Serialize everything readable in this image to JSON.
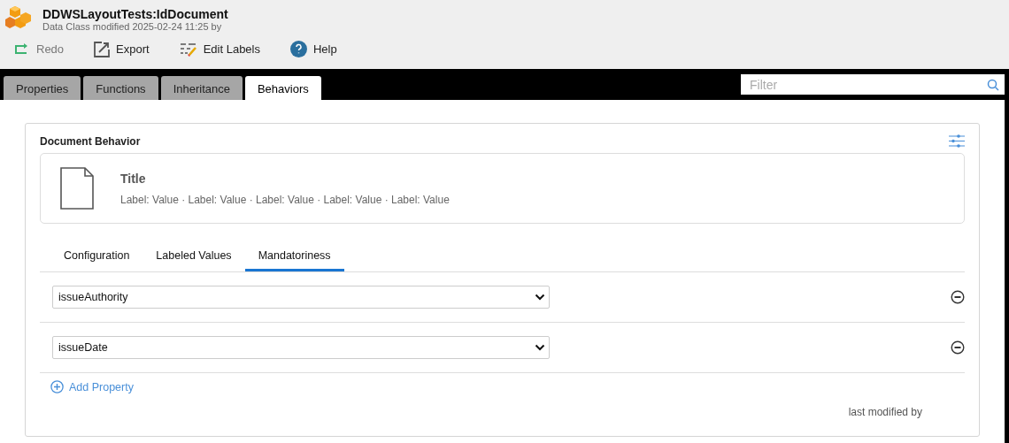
{
  "header": {
    "title": "DDWSLayoutTests:IdDocument",
    "subtitle": "Data Class modified 2025-02-24 11:25 by"
  },
  "toolbar": [
    {
      "kind": "redo",
      "label": "Redo",
      "disabled": true
    },
    {
      "kind": "export",
      "label": "Export",
      "disabled": false
    },
    {
      "kind": "edit",
      "label": "Edit Labels",
      "disabled": false
    },
    {
      "kind": "help",
      "label": "Help",
      "disabled": false
    }
  ],
  "tabs": [
    {
      "label": "Properties",
      "selected": false
    },
    {
      "label": "Functions",
      "selected": false
    },
    {
      "label": "Inheritance",
      "selected": false
    },
    {
      "label": "Behaviors",
      "selected": true
    }
  ],
  "filter": {
    "placeholder": "Filter"
  },
  "behavior": {
    "title": "Document Behavior",
    "preview": {
      "title": "Title",
      "labels": "Label: Value · Label: Value · Label: Value · Label: Value · Label: Value"
    },
    "subtabs": [
      {
        "label": "Configuration",
        "selected": false
      },
      {
        "label": "Labeled Values",
        "selected": false
      },
      {
        "label": "Mandatoriness",
        "selected": true
      }
    ],
    "properties": [
      {
        "value": "issueAuthority"
      },
      {
        "value": "issueDate"
      }
    ],
    "add_button": "Add Property",
    "footer": "last modified by"
  }
}
